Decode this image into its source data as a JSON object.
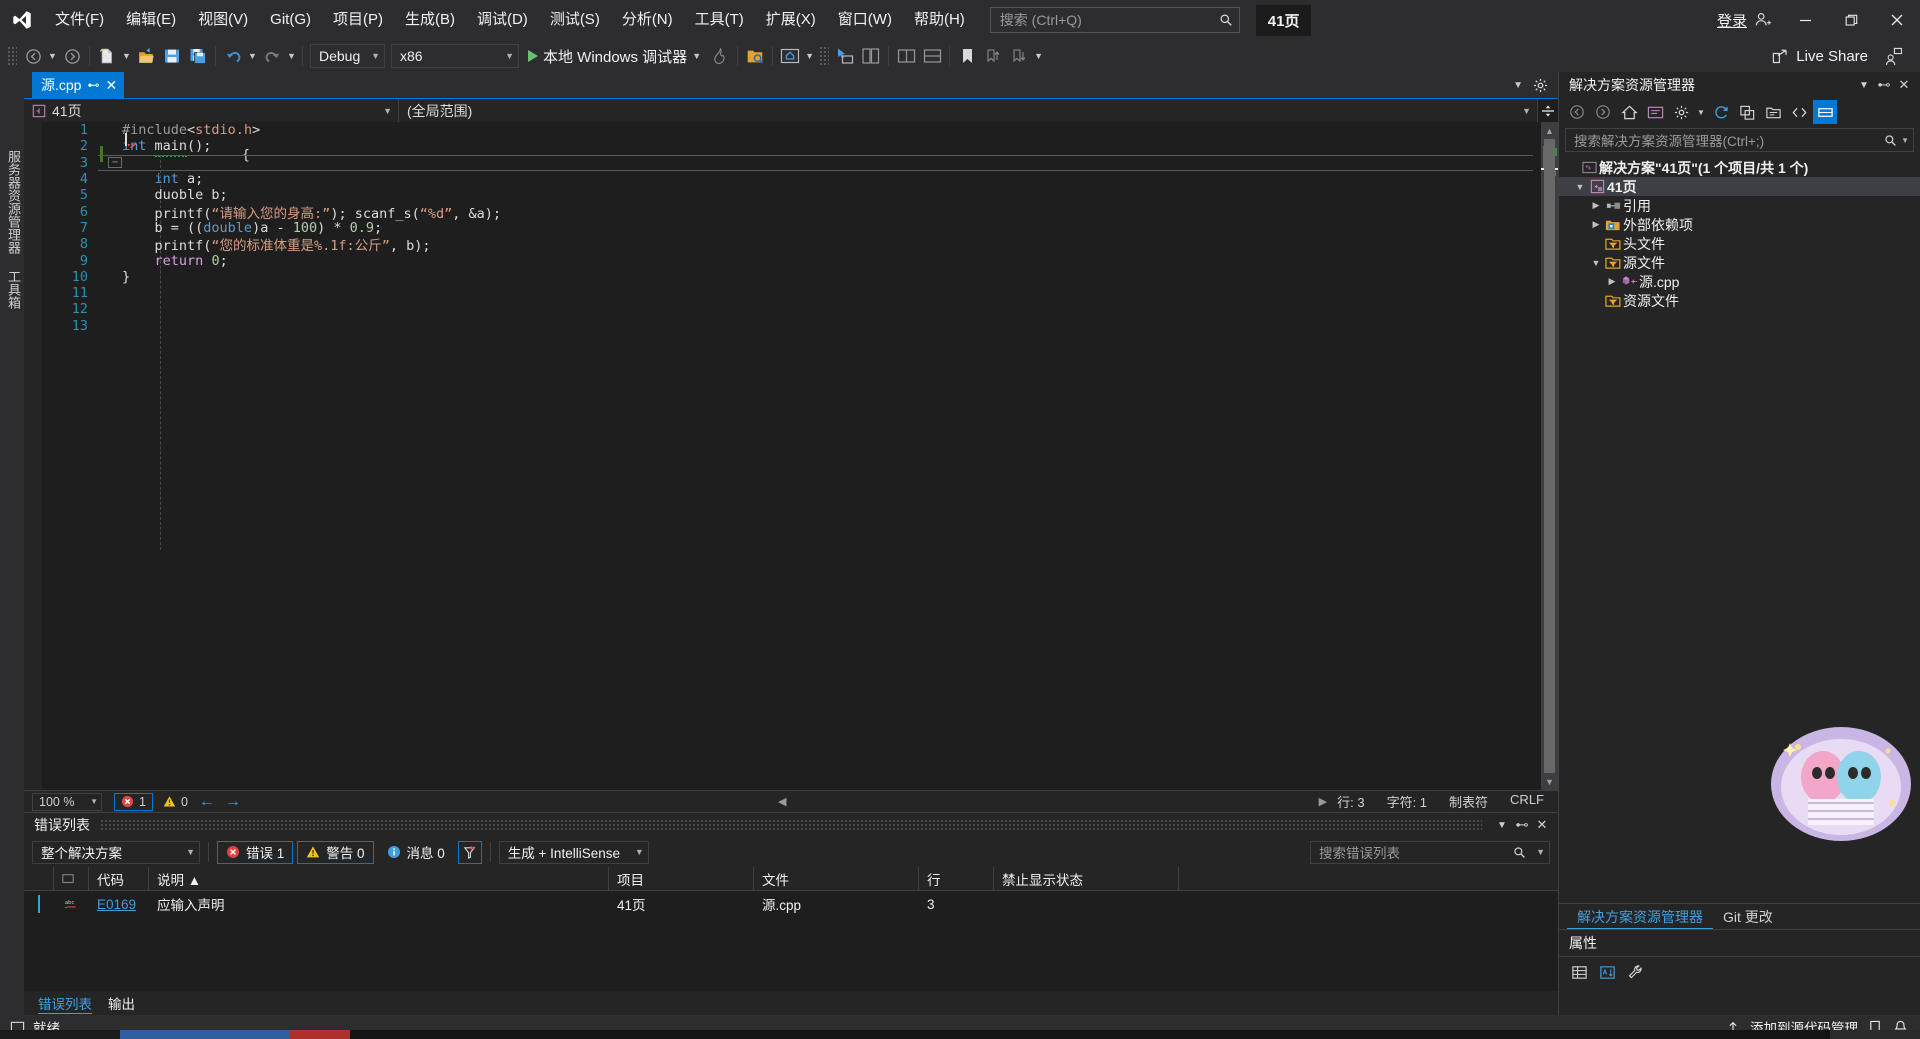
{
  "titlebar": {
    "logo": "vs-logo",
    "menu": [
      {
        "label": "文件(F)",
        "key": "F"
      },
      {
        "label": "编辑(E)",
        "key": "E"
      },
      {
        "label": "视图(V)",
        "key": "V"
      },
      {
        "label": "Git(G)",
        "key": "G"
      },
      {
        "label": "项目(P)",
        "key": "P"
      },
      {
        "label": "生成(B)",
        "key": "B"
      },
      {
        "label": "调试(D)",
        "key": "D"
      },
      {
        "label": "测试(S)",
        "key": "S"
      },
      {
        "label": "分析(N)",
        "key": "N"
      },
      {
        "label": "工具(T)",
        "key": "T"
      },
      {
        "label": "扩展(X)",
        "key": "X"
      },
      {
        "label": "窗口(W)",
        "key": "W"
      },
      {
        "label": "帮助(H)",
        "key": "H"
      }
    ],
    "search_placeholder": "搜索 (Ctrl+Q)",
    "page_badge": "41页",
    "signin_label": "登录",
    "minimize": "—",
    "maximize": "❐",
    "close": "✕"
  },
  "toolbar": {
    "config": "Debug",
    "platform": "x86",
    "run_label": "本地 Windows 调试器",
    "live_share_label": "Live Share"
  },
  "vertical_tabs": [
    {
      "label": "服务器资源管理器"
    },
    {
      "label": "工具箱"
    }
  ],
  "editor": {
    "tab_name": "源.cpp",
    "scope_left": "41页",
    "scope_right": "(全局范围)",
    "lines": [
      {
        "n": "1",
        "html": "<span class=\"pp\">#include</span><span class=\"pl\">&lt;</span><span class=\"hdr\">stdio.h</span><span class=\"pl\">&gt;</span>",
        "text": "#include<stdio.h>"
      },
      {
        "n": "2",
        "html": "<span class=\"kw\">int</span> <span class=\"pl squig\">main</span><span class=\"pl\">();</span>",
        "text": "int main();"
      },
      {
        "n": "3",
        "html": "<span class=\"pl\">{</span>",
        "text": "{"
      },
      {
        "n": "4",
        "html": "    <span class=\"kw\">int</span> <span class=\"pl\">a;</span>",
        "text": "    int a;"
      },
      {
        "n": "5",
        "html": "    <span class=\"pl\">duoble b;</span>",
        "text": "    duoble b;"
      },
      {
        "n": "6",
        "html": "    <span class=\"pl\">printf(</span><span class=\"str\">“请输入您的身高:”</span><span class=\"pl\">); scanf_s(</span><span class=\"str\">“%d”</span><span class=\"pl\">, &amp;a);</span>",
        "text": "    printf(“请输入您的身高:”); scanf_s(“%d”, &a);"
      },
      {
        "n": "7",
        "html": "    <span class=\"pl\">b = ((</span><span class=\"kw\">double</span><span class=\"pl\">)a - </span><span class=\"num\">100</span><span class=\"pl\">) * </span><span class=\"num\">0.9</span><span class=\"pl\">;</span>",
        "text": "    b = ((double)a - 100) * 0.9;"
      },
      {
        "n": "8",
        "html": "    <span class=\"pl\">printf(</span><span class=\"str\">“您的标准体重是%.1f:公斤”</span><span class=\"pl\">, b);</span>",
        "text": "    printf(“您的标准体重是%.1f:公斤”, b);"
      },
      {
        "n": "9",
        "html": "    <span class=\"ret\">return</span> <span class=\"num\">0</span><span class=\"pl\">;</span>",
        "text": "    return 0;"
      },
      {
        "n": "10",
        "html": "<span class=\"pl\">}</span>",
        "text": "}"
      },
      {
        "n": "11",
        "html": "",
        "text": ""
      },
      {
        "n": "12",
        "html": "",
        "text": ""
      },
      {
        "n": "13",
        "html": "",
        "text": ""
      }
    ],
    "status": {
      "zoom": "100 %",
      "error_count": "1",
      "warning_count": "0",
      "line_label": "行: 3",
      "col_label": "字符: 1",
      "tab_label": "制表符",
      "eol_label": "CRLF"
    }
  },
  "error_list": {
    "title": "错误列表",
    "scope": "整个解决方案",
    "errors_label": "错误 1",
    "warnings_label": "警告 0",
    "messages_label": "消息 0",
    "build_filter": "生成 + IntelliSense",
    "search_placeholder": "搜索错误列表",
    "columns": [
      "",
      "",
      "代码",
      "说明 ▲",
      "项目",
      "文件",
      "行",
      "禁止显示状态"
    ],
    "rows": [
      {
        "icon": "abc",
        "code": "E0169",
        "description": "应输入声明",
        "project": "41页",
        "file": "源.cpp",
        "line": "3",
        "suppression": ""
      }
    ],
    "tabs": [
      {
        "label": "错误列表",
        "active": true
      },
      {
        "label": "输出",
        "active": false
      }
    ]
  },
  "solution_explorer": {
    "title": "解决方案资源管理器",
    "search_placeholder": "搜索解决方案资源管理器(Ctrl+;)",
    "tree": [
      {
        "indent": 0,
        "arrow": "",
        "icon": "solution-icon",
        "label": "解决方案\"41页\"(1 个项目/共 1 个)",
        "bold": true,
        "selected": false
      },
      {
        "indent": 1,
        "arrow": "▼",
        "icon": "project-icon",
        "label": "41页",
        "bold": true,
        "selected": true
      },
      {
        "indent": 2,
        "arrow": "▶",
        "icon": "references-icon",
        "label": "引用",
        "bold": false,
        "selected": false
      },
      {
        "indent": 2,
        "arrow": "▶",
        "icon": "deps-icon",
        "label": "外部依赖项",
        "bold": false,
        "selected": false
      },
      {
        "indent": 2,
        "arrow": "",
        "icon": "folder-icon",
        "label": "头文件",
        "bold": false,
        "selected": false
      },
      {
        "indent": 2,
        "arrow": "▼",
        "icon": "folder-icon",
        "label": "源文件",
        "bold": false,
        "selected": false
      },
      {
        "indent": 3,
        "arrow": "▶",
        "icon": "cpp-icon",
        "label": "源.cpp",
        "bold": false,
        "selected": false
      },
      {
        "indent": 2,
        "arrow": "",
        "icon": "folder-icon",
        "label": "资源文件",
        "bold": false,
        "selected": false
      }
    ],
    "tabs": [
      {
        "label": "解决方案资源管理器",
        "active": true
      },
      {
        "label": "Git 更改",
        "active": false
      }
    ],
    "properties_title": "属性"
  },
  "statusbar": {
    "ready": "就绪",
    "source_control": "添加到源代码管理"
  }
}
